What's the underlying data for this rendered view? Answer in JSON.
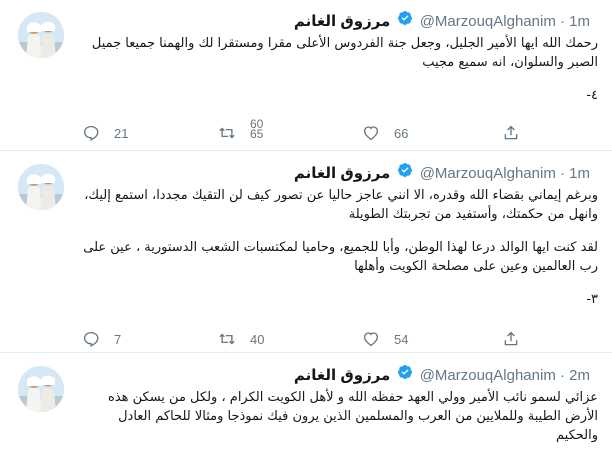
{
  "tweets": [
    {
      "name": "مرزوق الغانم",
      "handle": "@MarzouqAlghanim",
      "dot": "·",
      "time": "1m",
      "paragraphs": [
        "رحمك الله ايها الأمير الجليل، وجعل جنة الفردوس الأعلى مقرا ومستقرا لك والهمنا جميعا جميل الصبر والسلوان، انه سميع مجيب"
      ],
      "counter": "٤-",
      "replies": "21",
      "retweets": "",
      "retweets_partial": "60\n65",
      "likes": "66"
    },
    {
      "name": "مرزوق الغانم",
      "handle": "@MarzouqAlghanim",
      "dot": "·",
      "time": "1m",
      "paragraphs": [
        "وبرغم إيماني بقضاء الله وقدره، الا انني عاجز حاليا عن تصور كيف لن التقيك مجددا، استمع إليك، وانهل من حكمتك، وأستفيد من تجربتك الطويلة",
        "لقد كنت ايها الوالد درعا لهذا الوطن، وأبا للجميع، وحاميا لمكتسبات الشعب الدستورية ، عين على رب العالمين وعين على مصلحة الكويت وأهلها"
      ],
      "counter": "٣-",
      "replies": "7",
      "retweets": "40",
      "likes": "54"
    },
    {
      "name": "مرزوق الغانم",
      "handle": "@MarzouqAlghanim",
      "dot": "·",
      "time": "2m",
      "paragraphs": [
        "عزائي لسمو نائب الأمير وولي العهد حفظه الله و لأهل الكويت الكرام ، ولكل من يسكن هذه الأرض الطيبة وللملايين من العرب والمسلمين الذين يرون فيك نموذجا ومثالا للحاكم العادل والحكيم"
      ]
    }
  ],
  "colors": {
    "verified": "#1da1f2",
    "muted": "#657786",
    "border": "#e6ecf0",
    "text": "#14171a"
  },
  "icons": {
    "reply": "reply-icon",
    "retweet": "retweet-icon",
    "like": "like-icon",
    "share": "share-icon",
    "verified": "verified-badge-icon"
  }
}
